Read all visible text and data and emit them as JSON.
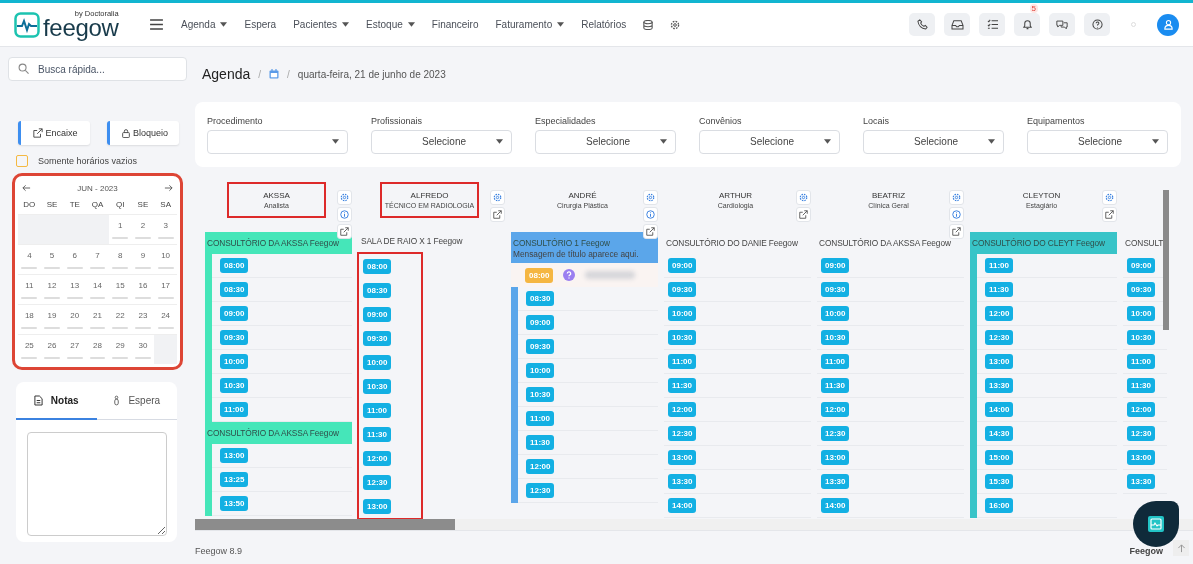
{
  "topbar": {
    "logo": {
      "name": "feegow",
      "tagline": "by Doctoralia"
    },
    "menu": [
      {
        "label": "Agenda",
        "dropdown": true
      },
      {
        "label": "Espera",
        "dropdown": false
      },
      {
        "label": "Pacientes",
        "dropdown": true
      },
      {
        "label": "Estoque",
        "dropdown": true
      },
      {
        "label": "Financeiro",
        "dropdown": false
      },
      {
        "label": "Faturamento",
        "dropdown": true
      },
      {
        "label": "Relatórios",
        "dropdown": false
      }
    ],
    "notification_count": "5"
  },
  "sidebar": {
    "search": {
      "placeholder": "Busca rápida..."
    },
    "buttons": [
      {
        "label": "Encaixe"
      },
      {
        "label": "Bloqueio"
      }
    ],
    "empty_only": {
      "label": "Somente horários vazios",
      "checked": false
    },
    "calendar": {
      "month": "JUN - 2023",
      "highlighted": true,
      "weekdays": [
        "DO",
        "SE",
        "TE",
        "QA",
        "QI",
        "SE",
        "SA"
      ],
      "weeks": [
        [
          {
            "kind": "blank"
          },
          {
            "kind": "blank"
          },
          {
            "kind": "blank"
          },
          {
            "kind": "blank"
          },
          {
            "kind": "day",
            "label": "1"
          },
          {
            "kind": "day",
            "label": "2"
          },
          {
            "kind": "day",
            "label": "3"
          }
        ],
        [
          {
            "kind": "day",
            "label": "4"
          },
          {
            "kind": "day",
            "label": "5"
          },
          {
            "kind": "day",
            "label": "6"
          },
          {
            "kind": "day",
            "label": "7"
          },
          {
            "kind": "day",
            "label": "8"
          },
          {
            "kind": "day",
            "label": "9"
          },
          {
            "kind": "day",
            "label": "10"
          }
        ],
        [
          {
            "kind": "day",
            "label": "11"
          },
          {
            "kind": "day",
            "label": "12"
          },
          {
            "kind": "day",
            "label": "13"
          },
          {
            "kind": "day",
            "label": "14"
          },
          {
            "kind": "day",
            "label": "15"
          },
          {
            "kind": "day",
            "label": "16"
          },
          {
            "kind": "day",
            "label": "17"
          }
        ],
        [
          {
            "kind": "day",
            "label": "18"
          },
          {
            "kind": "day",
            "label": "19"
          },
          {
            "kind": "day",
            "label": "20"
          },
          {
            "kind": "day",
            "label": "21"
          },
          {
            "kind": "day",
            "label": "22"
          },
          {
            "kind": "day",
            "label": "23"
          },
          {
            "kind": "day",
            "label": "24"
          }
        ],
        [
          {
            "kind": "day",
            "label": "25"
          },
          {
            "kind": "day",
            "label": "26"
          },
          {
            "kind": "day",
            "label": "27"
          },
          {
            "kind": "day",
            "label": "28"
          },
          {
            "kind": "day",
            "label": "29"
          },
          {
            "kind": "day",
            "label": "30"
          },
          {
            "kind": "blank"
          }
        ]
      ]
    },
    "tabs": [
      {
        "label": "Notas",
        "selected": true
      },
      {
        "label": "Espera",
        "selected": false
      }
    ]
  },
  "breadcrumb": {
    "title": "Agenda",
    "separators": [
      "/",
      "/"
    ],
    "date": "quarta-feira, 21 de junho de 2023"
  },
  "filters": [
    {
      "label": "Procedimento"
    },
    {
      "label": "Profissionais",
      "value": "Selecione"
    },
    {
      "label": "Especialidades",
      "value": "Selecione"
    },
    {
      "label": "Convênios",
      "value": "Selecione"
    },
    {
      "label": "Locais",
      "value": "Selecione"
    },
    {
      "label": "Equipamentos",
      "value": "Selecione"
    }
  ],
  "columns": [
    {
      "professional": {
        "name": "AKSSA",
        "role": "Analista",
        "info": true,
        "highlighted": true
      },
      "slots_highlighted": false,
      "blocks": [
        {
          "location": "CONSULTÓRIO DA AKSSA Feegow",
          "color": "#45e6b9",
          "slots": [
            "08:00",
            "08:30",
            "09:00",
            "09:30",
            "10:00",
            "10:30",
            "11:00"
          ]
        },
        {
          "location": "CONSULTÓRIO DA AKSSA Feegow",
          "color": "#45e6b9",
          "slots": [
            "13:00",
            "13:25",
            "13:50"
          ]
        }
      ]
    },
    {
      "professional": {
        "name": "ALFREDO",
        "role": "TÉCNICO EM RADIOLOGIA",
        "info": false,
        "highlighted": true
      },
      "slots_highlighted": true,
      "blocks": [
        {
          "location": "SALA DE RAIO X 1 Feegow",
          "slots": [
            "08:00",
            "08:30",
            "09:00",
            "09:30",
            "10:00",
            "10:30",
            "11:00",
            "11:30",
            "12:00",
            "12:30",
            "13:00"
          ]
        }
      ]
    },
    {
      "professional": {
        "name": "ANDRÉ",
        "role": "Cirurgia Plástica",
        "info": true,
        "highlighted": false
      },
      "slots_highlighted": false,
      "blocks": [
        {
          "location": "CONSULTÓRIO 1 Feegow",
          "message": "Mensagem de título aparece aqui.",
          "color": "#5ba6ea",
          "appointment": {
            "time": "08:00"
          },
          "slots": [
            "08:30",
            "09:00",
            "09:30",
            "10:00",
            "10:30",
            "11:00",
            "11:30",
            "12:00",
            "12:30"
          ]
        }
      ]
    },
    {
      "professional": {
        "name": "ARTHUR",
        "role": "Cardiologia",
        "info": false,
        "highlighted": false
      },
      "slots_highlighted": false,
      "blocks": [
        {
          "location": "CONSULTÓRIO DO DANIE Feegow",
          "slots": [
            "09:00",
            "09:30",
            "10:00",
            "10:30",
            "11:00",
            "11:30",
            "12:00",
            "12:30",
            "13:00",
            "13:30",
            "14:00"
          ]
        }
      ]
    },
    {
      "professional": {
        "name": "BEATRIZ",
        "role": "Clínica Geral",
        "info": true,
        "highlighted": false
      },
      "slots_highlighted": false,
      "blocks": [
        {
          "location": "CONSULTÓRIO DA AKSSA Feegow",
          "slots": [
            "09:00",
            "09:30",
            "10:00",
            "10:30",
            "11:00",
            "11:30",
            "12:00",
            "12:30",
            "13:00",
            "13:30",
            "14:00"
          ]
        }
      ]
    },
    {
      "professional": {
        "name": "CLEYTON",
        "role": "Estagiário",
        "info": false,
        "highlighted": false
      },
      "slots_highlighted": false,
      "blocks": [
        {
          "location": "CONSULTÓRIO DO CLEYT Feegow",
          "color": "#38c4c8",
          "slots": [
            "11:00",
            "11:30",
            "12:00",
            "12:30",
            "13:00",
            "13:30",
            "14:00",
            "14:30",
            "15:00",
            "15:30",
            "16:00"
          ]
        }
      ]
    },
    {
      "slots_highlighted": false,
      "blocks": [
        {
          "location": "CONSULT",
          "slots": [
            "09:00",
            "09:30",
            "10:00",
            "10:30",
            "11:00",
            "11:30",
            "12:00",
            "12:30",
            "13:00",
            "13:30"
          ]
        }
      ]
    }
  ],
  "footer": {
    "version": "Feegow 8.9",
    "brand": "Feegow"
  }
}
